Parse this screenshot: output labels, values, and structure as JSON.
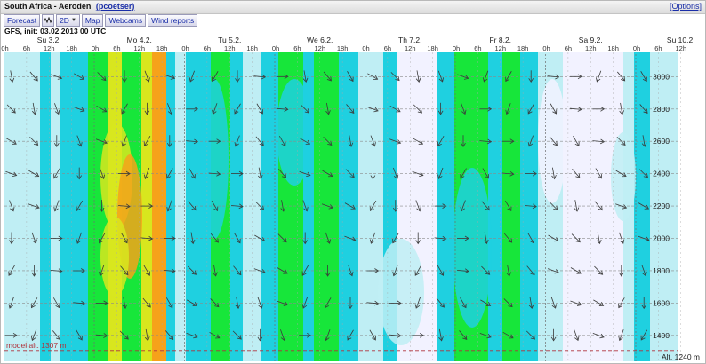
{
  "header": {
    "location": "South Africa - Aeroden",
    "user": "(pcoetser)",
    "options": "[Options]"
  },
  "toolbar": {
    "forecast": "Forecast",
    "mode": "2D",
    "map": "Map",
    "webcams": "Webcams",
    "wind_reports": "Wind reports"
  },
  "model_info": "GFS, init: 03.02.2013 00 UTC",
  "colors": {
    "calm": "#f2f2ff",
    "light": "#bfeef4",
    "medium": "#1fd0e0",
    "strong": "#17e63a",
    "gusty": "#d8e61e",
    "extreme": "#f6a21a"
  },
  "chart_data": {
    "type": "heatmap",
    "days": [
      "Su 3.2.",
      "Mo 4.2.",
      "Tu 5.2.",
      "We 6.2.",
      "Th 7.2.",
      "Fr 8.2.",
      "Sa 9.2.",
      "Su 10.2."
    ],
    "hours": [
      "0h",
      "6h",
      "12h",
      "18h"
    ],
    "altitude_ticks": [
      1400,
      1600,
      1800,
      2000,
      2200,
      2400,
      2600,
      2800,
      3000
    ],
    "ylim": [
      1240,
      3150
    ],
    "grid": true,
    "model_alt_label": "model alt. 1307 m",
    "model_alt_value": 1307,
    "alt_label": "Alt. 1240 m"
  }
}
